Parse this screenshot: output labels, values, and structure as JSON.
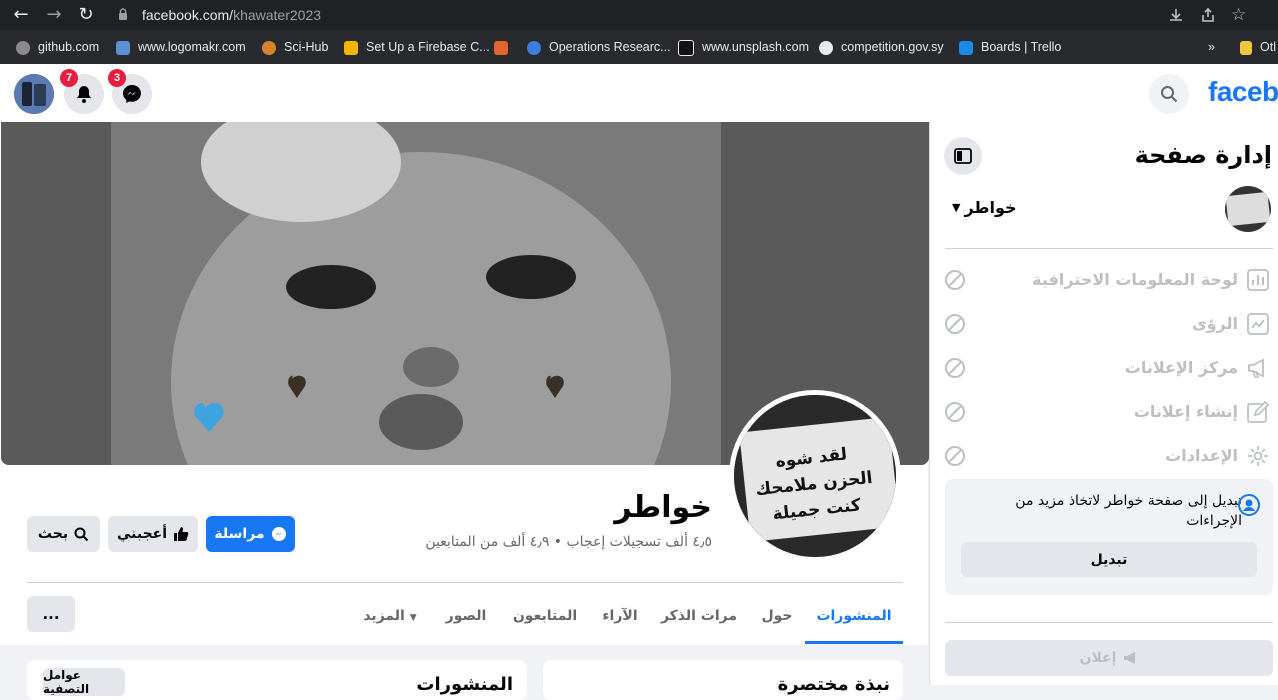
{
  "browser": {
    "url_host": "facebook.com/",
    "url_path": "khawater2023",
    "bookmarks": [
      {
        "label": "github.com",
        "color": "#8a8a8a"
      },
      {
        "label": "www.logomakr.com",
        "color": "#5b8fd6"
      },
      {
        "label": "Sci-Hub",
        "color": "#d9822b"
      },
      {
        "label": "Set Up a Firebase C...",
        "color": "#f5b400"
      },
      {
        "label": "",
        "color": "#e0642b"
      },
      {
        "label": "Operations Researc...",
        "color": "#3b7dd8"
      },
      {
        "label": "www.unsplash.com",
        "color": "#111111"
      },
      {
        "label": "competition.gov.sy",
        "color": "#e8eaed"
      },
      {
        "label": "Boards | Trello",
        "color": "#1e88e5"
      }
    ],
    "bookmarks_more": "»",
    "bookmarks_other": "Otl"
  },
  "header": {
    "logo_text": "faceb",
    "notifications_count": "7",
    "messenger_count": "3"
  },
  "profile": {
    "name": "خواطر",
    "stats": "٤٫٥ ألف تسجيلات إعجاب • ٤٫٩ ألف من المتابعين",
    "cover_text": "",
    "pic_caption": "لقد شوه الحزن ملامحك كنت جميلة"
  },
  "actions": {
    "message": "مراسلة",
    "like": "أعجبني",
    "search": "بحث"
  },
  "tabs": [
    {
      "label": "المنشورات",
      "active": true
    },
    {
      "label": "حول",
      "active": false
    },
    {
      "label": "مرات الذكر",
      "active": false
    },
    {
      "label": "الآراء",
      "active": false
    },
    {
      "label": "المتابعون",
      "active": false
    },
    {
      "label": "الصور",
      "active": false
    },
    {
      "label": "المزيد",
      "active": false
    }
  ],
  "more_menu": "...",
  "bottom": {
    "left_chip": "عوامل التصفية",
    "left_title": "المنشورات",
    "right_title": "نبذة مختصرة"
  },
  "sidebar": {
    "title": "إدارة صفحة",
    "page_name": "خواطر",
    "items": [
      {
        "label": "لوحة المعلومات الاحترافية",
        "icon": "chart-icon"
      },
      {
        "label": "الرؤى",
        "icon": "insights-icon"
      },
      {
        "label": "مركز الإعلانات",
        "icon": "megaphone-icon"
      },
      {
        "label": "إنشاء إعلانات",
        "icon": "pencil-icon"
      },
      {
        "label": "الإعدادات",
        "icon": "gear-icon"
      }
    ],
    "switch_text": "تبديل إلى صفحة خواطر لاتخاذ مزيد من الإجراءات",
    "switch_button": "تبديل",
    "ad_button": "إعلان"
  }
}
